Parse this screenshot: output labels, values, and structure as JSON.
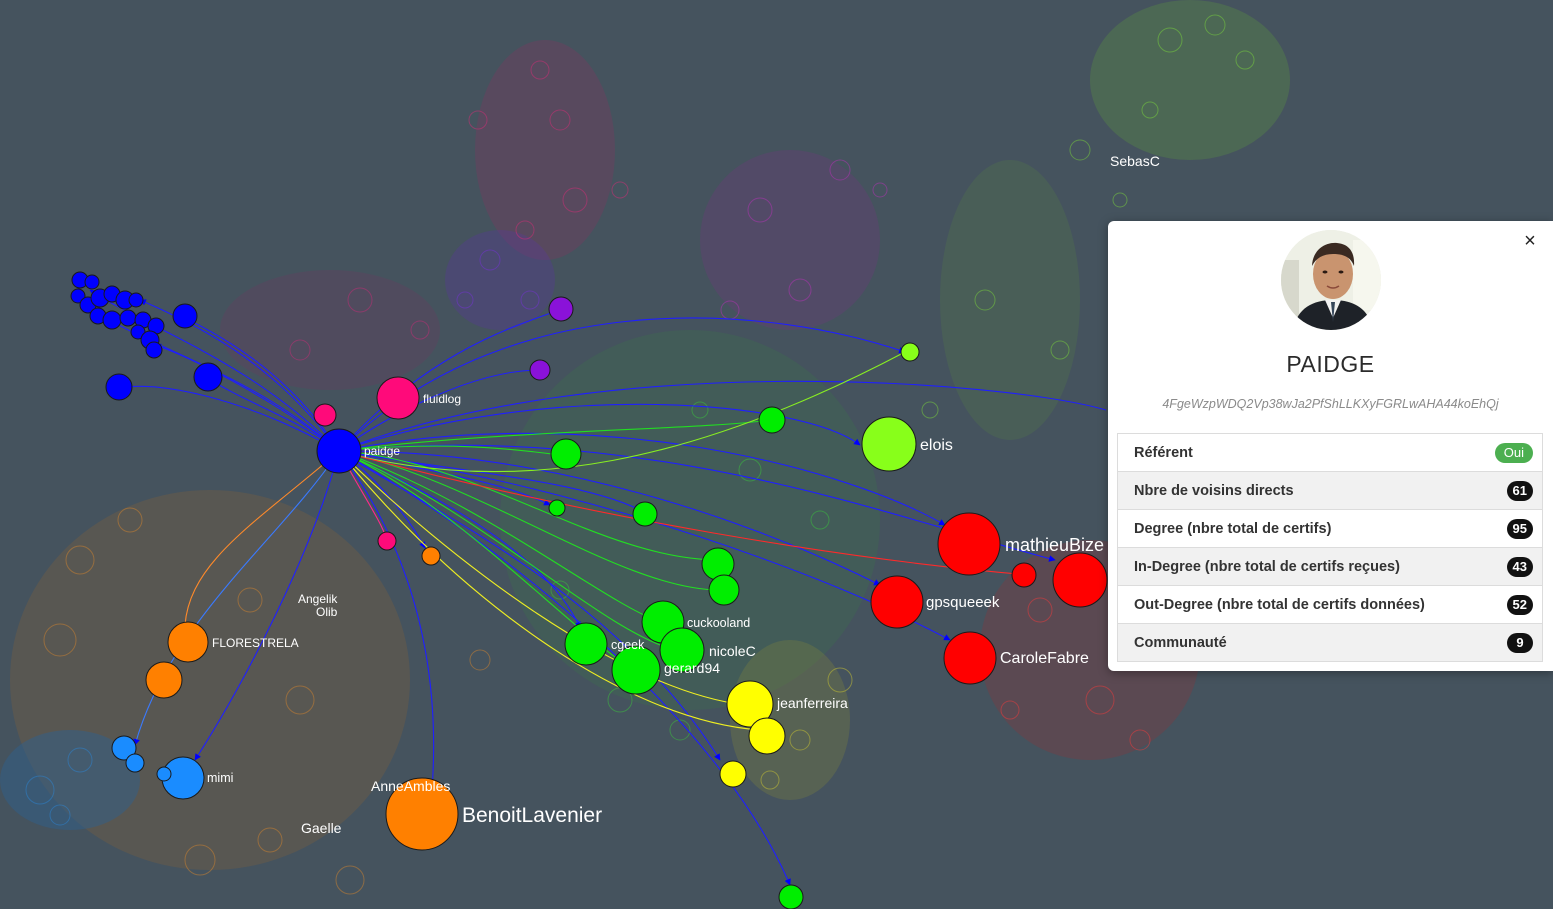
{
  "graph": {
    "labels": {
      "sebasc": "SebasC",
      "fluidlog": "fluidlog",
      "paidge": "paidge",
      "elois": "elois",
      "mathieubize": "mathieuBize",
      "gpsqueeek": "gpsqueeek",
      "carolefabre": "CaroleFabre",
      "cuckooland": "cuckooland",
      "cgeek": "cgeek",
      "nicolec": "nicoleC",
      "gerard94": "gerard94",
      "jeanferreira": "jeanferreira",
      "angelik": "Angelik",
      "olib": "Olib",
      "florestrela": "FLORESTRELA",
      "mimi": "mimi",
      "anneambles": "AnneAmbles",
      "benoitlavenier": "BenoitLavenier",
      "gaelle": "Gaelle"
    },
    "colors": {
      "background": "#45535e",
      "blue": "#0000ff",
      "pink": "#ff0a7a",
      "purple": "#8a12d9",
      "green": "#00ee00",
      "lime": "#88ff1a",
      "red": "#ff0000",
      "orange": "#ff8000",
      "yellow": "#ffff00",
      "skyblue": "#1a8cff",
      "magenta": "#cc1fcc"
    }
  },
  "panel": {
    "close_icon": "×",
    "avatar_icon": "user-avatar",
    "name": "PAIDGE",
    "pubkey": "4FgeWzpWDQ2Vp38wJa2PfShLLKXyFGRLwAHA44koEhQj",
    "stats": [
      {
        "label": "Référent",
        "value": "Oui"
      },
      {
        "label": "Nbre de voisins directs",
        "value": "61"
      },
      {
        "label": "Degree (nbre total de certifs)",
        "value": "95"
      },
      {
        "label": "In-Degree (nbre total de certifs reçues)",
        "value": "43"
      },
      {
        "label": "Out-Degree (nbre total de certifs données)",
        "value": "52"
      },
      {
        "label": "Communauté",
        "value": "9"
      }
    ]
  }
}
